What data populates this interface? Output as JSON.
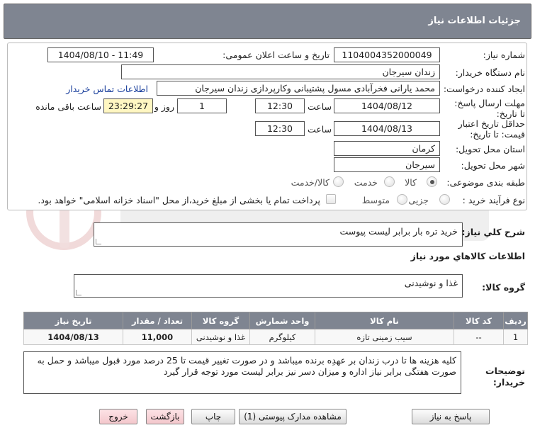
{
  "header": {
    "title": "جزئیات اطلاعات نیاز"
  },
  "form": {
    "need_number_label": "شماره نیاز:",
    "need_number": "1104004352000049",
    "announce_label": "تاریخ و ساعت اعلان عمومی:",
    "announce_value": "1404/08/10 - 11:49",
    "buyer_org_label": "نام دستگاه خریدار:",
    "buyer_org": "زندان سیرجان",
    "creator_label": "ایجاد کننده درخواست:",
    "creator": "محمد یارانی فخرآبادی مسول پشتیبانی وکارپردازی زندان سیرجان",
    "contact_link": "اطلاعات تماس خریدار",
    "reply_deadline_label": "مهلت ارسال پاسخ: تا تاریخ:",
    "reply_date": "1404/08/12",
    "time_label": "ساعت",
    "reply_time": "12:30",
    "days_value": "1",
    "days_label": "روز و",
    "remaining_time": "23:29:27",
    "remaining_label": "ساعت باقی مانده",
    "price_valid_label": "حداقل تاریخ اعتبار قیمت: تا تاریخ:",
    "price_date": "1404/08/13",
    "price_time": "12:30",
    "province_label": "استان محل تحویل:",
    "province": "کرمان",
    "city_label": "شهر محل تحویل:",
    "city": "سیرجان",
    "category_label": "طبقه بندی موضوعی:",
    "category_options": [
      "کالا",
      "خدمت",
      "کالا/خدمت"
    ],
    "process_label": "نوع فرآیند خرید :",
    "process_options": [
      "جزیی",
      "متوسط"
    ],
    "payment_note": "پرداخت تمام یا بخشی از مبلغ خرید،از محل \"اسناد خزانه اسلامی\" خواهد بود."
  },
  "summary": {
    "label": "شرح کلي نياز:",
    "value": "خرید تره بار برابر لیست پیوست"
  },
  "goods": {
    "section_title": "اطلاعات کالاهاي مورد نياز",
    "group_label": "گروه کالا:",
    "group_value": "غذا و نوشیدنی",
    "columns": [
      "ردیف",
      "کد کالا",
      "نام کالا",
      "واحد شمارش",
      "گروه کالا",
      "تعداد / مقدار",
      "تاریخ نیاز"
    ],
    "rows": [
      [
        "1",
        "--",
        "سیب زمینی تازه",
        "کیلوگرم",
        "غذا و نوشیدنی",
        "11,000",
        "1404/08/13"
      ]
    ]
  },
  "buyer_notes": {
    "label": "توضیحات خریدار:",
    "value": "کلیه هزینه ها تا درب زندان  بر عهدِه برنده میباشد و در صورت تغییر قیمت تا 25 درصد مورد قبول  میباشد  و حمل به صورت هفتگی برابر نیاز اداره و میزان دسر نیز برابر لیست مورد توجه قرار گیرد"
  },
  "buttons": {
    "reply": "پاسخ به نیاز",
    "attachments": "مشاهده مدارک پیوستی (1)",
    "print": "چاپ",
    "back": "بازگشت",
    "exit": "خروج"
  },
  "colors": {
    "header_bg": "#7f8591",
    "yellow_box": "#fff7c2",
    "link": "#1a3f9c"
  }
}
